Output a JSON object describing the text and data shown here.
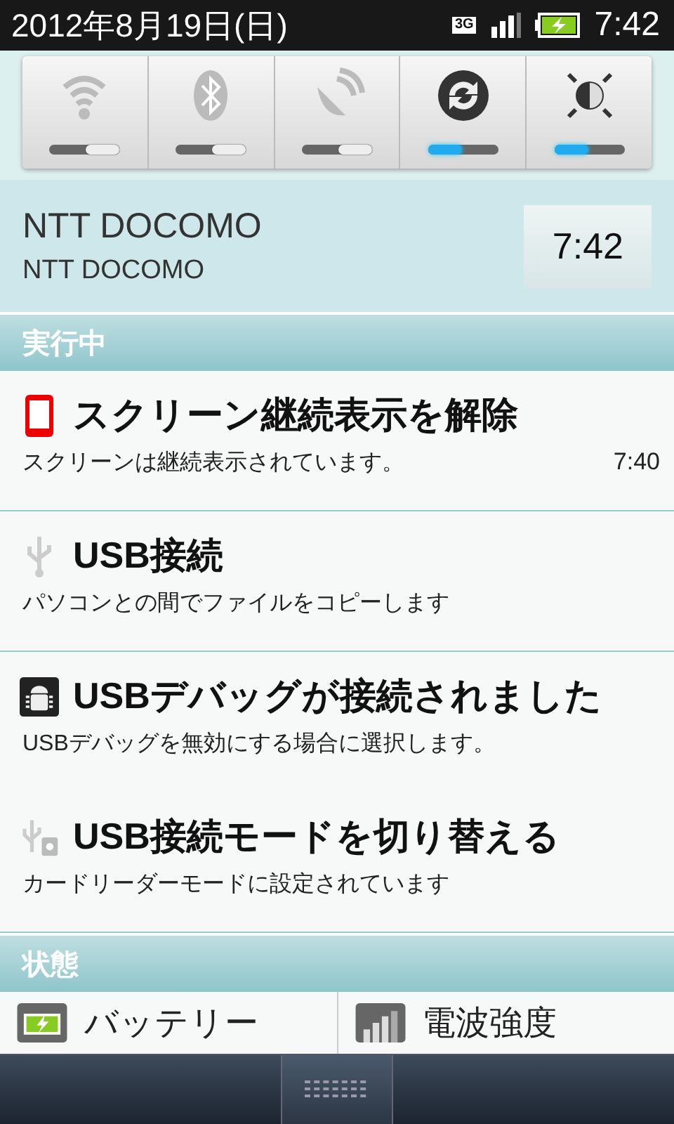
{
  "status_bar": {
    "date": "2012年8月19日(日)",
    "network": "3G",
    "time": "7:42"
  },
  "toggles": [
    {
      "on": false
    },
    {
      "on": false
    },
    {
      "on": false
    },
    {
      "on": true
    },
    {
      "on": true
    }
  ],
  "carrier": {
    "name": "NTT DOCOMO",
    "subname": "NTT DOCOMO",
    "time": "7:42"
  },
  "ongoing": {
    "header": "実行中",
    "items": [
      {
        "title": "スクリーン継続表示を解除",
        "text": "スクリーンは継続表示されています。",
        "time": "7:40"
      },
      {
        "title": "USB接続",
        "text": "パソコンとの間でファイルをコピーします"
      },
      {
        "title": "USBデバッグが接続されました",
        "text": "USBデバッグを無効にする場合に選択します。"
      },
      {
        "title": "USB接続モードを切り替える",
        "text": "カードリーダーモードに設定されています"
      }
    ]
  },
  "status": {
    "header": "状態",
    "tiles": [
      {
        "label": "バッテリー"
      },
      {
        "label": "電波強度"
      }
    ]
  }
}
